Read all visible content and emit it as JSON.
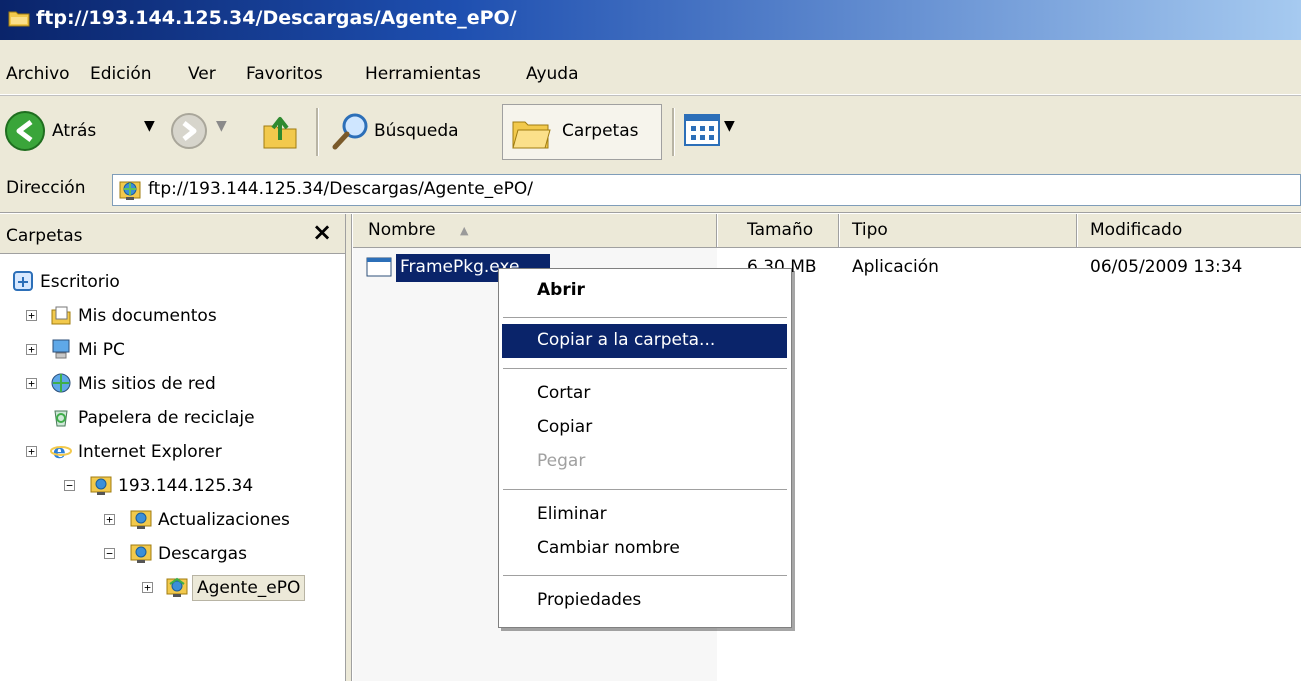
{
  "window": {
    "title": "ftp://193.144.125.34/Descargas/Agente_ePO/",
    "title_color": "#0a246a"
  },
  "menu": {
    "items": [
      "Archivo",
      "Edición",
      "Ver",
      "Favoritos",
      "Herramientas",
      "Ayuda"
    ]
  },
  "toolbar": {
    "back_label": "Atrás",
    "search_label": "Búsqueda",
    "folders_label": "Carpetas",
    "icons": [
      "back-arrow-icon",
      "forward-arrow-icon",
      "up-folder-icon",
      "search-icon",
      "folders-icon",
      "views-icon"
    ]
  },
  "address": {
    "label": "Dirección",
    "value": "ftp://193.144.125.34/Descargas/Agente_ePO/"
  },
  "folders_pane": {
    "title": "Carpetas",
    "close": "×",
    "tree": [
      {
        "label": "Escritorio",
        "icon": "desktop-icon"
      },
      {
        "label": "Mis documentos",
        "icon": "documents-icon"
      },
      {
        "label": "Mi PC",
        "icon": "computer-icon"
      },
      {
        "label": "Mis sitios de red",
        "icon": "network-icon"
      },
      {
        "label": "Papelera de reciclaje",
        "icon": "recycle-bin-icon"
      },
      {
        "label": "Internet Explorer",
        "icon": "ie-icon"
      },
      {
        "label": "193.144.125.34",
        "icon": "ftp-folder-icon"
      },
      {
        "label": "Actualizaciones",
        "icon": "ftp-folder-icon"
      },
      {
        "label": "Descargas",
        "icon": "ftp-folder-icon"
      },
      {
        "label": "Agente_ePO",
        "icon": "ftp-folder-open-icon"
      }
    ]
  },
  "file_list": {
    "columns": [
      "Nombre",
      "Tamaño",
      "Tipo",
      "Modificado"
    ],
    "rows": [
      {
        "name": "FramePkg.exe",
        "size": "6,30 MB",
        "type": "Aplicación",
        "modified": "06/05/2009 13:34"
      }
    ]
  },
  "context_menu": {
    "open": "Abrir",
    "copy_to_folder": "Copiar a la carpeta...",
    "cut": "Cortar",
    "copy": "Copiar",
    "paste": "Pegar",
    "delete": "Eliminar",
    "rename": "Cambiar nombre",
    "properties": "Propiedades",
    "highlight_color": "#0a246a"
  }
}
